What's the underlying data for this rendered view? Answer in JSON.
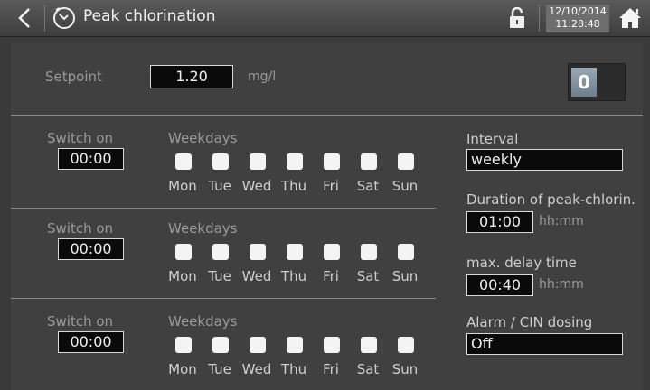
{
  "header": {
    "title": "Peak chlorination",
    "date": "12/10/2014",
    "time": "11:28:48"
  },
  "setpoint": {
    "label": "Setpoint",
    "value": "1.20",
    "unit": "mg/l"
  },
  "toggle": {
    "state_label": "0"
  },
  "weekdays": [
    "Mon",
    "Tue",
    "Wed",
    "Thu",
    "Fri",
    "Sat",
    "Sun"
  ],
  "schedules": [
    {
      "switch_label": "Switch on",
      "time": "00:00",
      "weekdays_label": "Weekdays"
    },
    {
      "switch_label": "Switch on",
      "time": "00:00",
      "weekdays_label": "Weekdays"
    },
    {
      "switch_label": "Switch on",
      "time": "00:00",
      "weekdays_label": "Weekdays"
    }
  ],
  "right": {
    "interval_label": "Interval",
    "interval_value": "weekly",
    "duration_label": "Duration of peak-chlorin.",
    "duration_value": "01:00",
    "duration_unit": "hh:mm",
    "delay_label": "max. delay time",
    "delay_value": "00:40",
    "delay_unit": "hh:mm",
    "alarm_label": "Alarm / CIN dosing",
    "alarm_value": "Off"
  },
  "icons": {
    "back": "chevron-left-icon",
    "title": "clock-icon",
    "lock": "unlock-icon",
    "home": "home-icon"
  }
}
